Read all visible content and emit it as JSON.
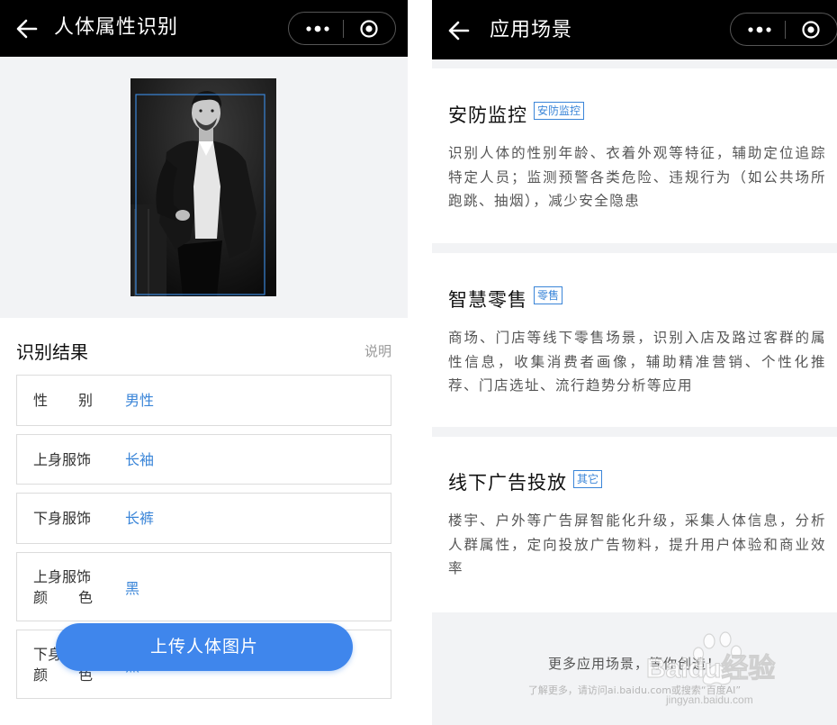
{
  "left_screen": {
    "nav": {
      "title": "人体属性识别",
      "back_icon": "back-arrow-icon",
      "more_icon": "more-dots-icon",
      "close_icon": "target-circle-icon"
    },
    "image": {
      "alt": "person-photo"
    },
    "result": {
      "title": "识别结果",
      "explain": "说明",
      "rows": [
        {
          "label": [
            "性",
            "别"
          ],
          "value": "男性"
        },
        {
          "label": "上身服饰",
          "value": "长袖"
        },
        {
          "label": "下身服饰",
          "value": "长裤"
        },
        {
          "label": "上身服饰",
          "label2": [
            "颜",
            "色"
          ],
          "value": "黑"
        },
        {
          "label": "下身服饰",
          "label2": [
            "颜",
            "色"
          ],
          "value": "黑"
        }
      ]
    },
    "upload_button": "上传人体图片"
  },
  "right_screen": {
    "nav": {
      "title": "应用场景",
      "back_icon": "back-arrow-icon",
      "more_icon": "more-dots-icon",
      "close_icon": "target-circle-icon"
    },
    "cards": [
      {
        "title": "安防监控",
        "tag": "安防监控",
        "desc": "识别人体的性别年龄、衣着外观等特征，辅助定位追踪特定人员；监测预警各类危险、违规行为（如公共场所跑跳、抽烟），减少安全隐患"
      },
      {
        "title": "智慧零售",
        "tag": "零售",
        "desc": "商场、门店等线下零售场景，识别入店及路过客群的属性信息，收集消费者画像，辅助精准营销、个性化推荐、门店选址、流行趋势分析等应用"
      },
      {
        "title": "线下广告投放",
        "tag": "其它",
        "desc": "楼宇、户外等广告屏智能化升级，采集人体信息，分析人群属性，定向投放广告物料，提升用户体验和商业效率"
      }
    ],
    "footer": {
      "main": "更多应用场景，等你创造！",
      "sub": "了解更多，请访问ai.baidu.com或搜索“百度AI”"
    }
  },
  "watermark": {
    "brand": "Baidu经验",
    "url": "jingyan.baidu.com"
  },
  "colors": {
    "accent": "#3a85d8",
    "button": "#3f86ec",
    "navbar": "#000000",
    "page_bg": "#f2f3f5"
  }
}
